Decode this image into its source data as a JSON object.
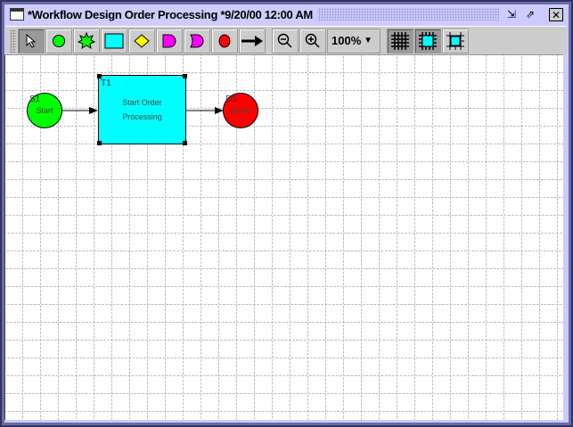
{
  "window": {
    "title": "*Workflow Design Order Processing *9/20/00 12:00 AM"
  },
  "toolbar": {
    "zoom_value": "100%",
    "tools": [
      "select",
      "start-node",
      "event-node",
      "task-node",
      "decision-node",
      "and-node",
      "or-node",
      "done-node",
      "connector"
    ]
  },
  "colors": {
    "start": "#00ff00",
    "task": "#00ffff",
    "done": "#ff0000",
    "decision": "#ffff00",
    "join": "#ff00ff"
  },
  "diagram": {
    "start": {
      "id": "S1",
      "label": "Start"
    },
    "task": {
      "id": "T1",
      "label_line1": "Start Order",
      "label_line2": "Processing"
    },
    "done": {
      "id": "D1",
      "label": "Done"
    }
  }
}
